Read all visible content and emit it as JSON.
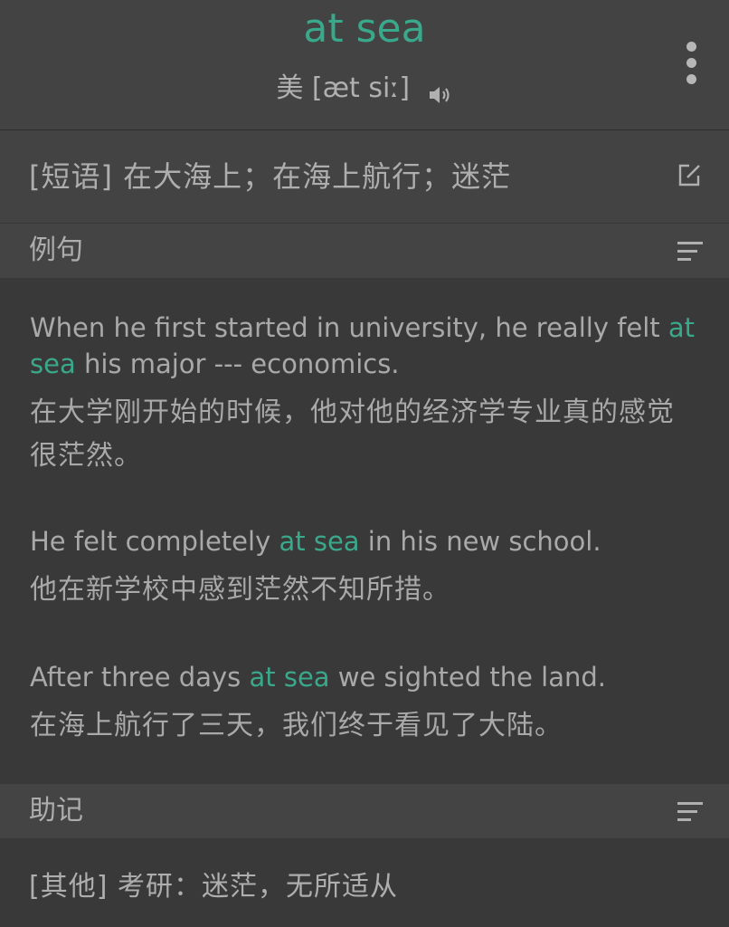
{
  "header": {
    "word": "at sea",
    "region": "美",
    "phonetic": "[æt siː]",
    "speaker_icon": "speaker-icon",
    "menu_icon": "more-vertical-icon"
  },
  "definition": {
    "text": "[短语] 在大海上；在海上航行；迷茫",
    "edit_icon": "edit-icon"
  },
  "sections": {
    "examples_title": "例句",
    "mnemonic_title": "助记",
    "sort_icon": "sort-icon"
  },
  "examples": [
    {
      "en_before": "When he first started in university, he really felt ",
      "en_highlight": "at sea",
      "en_after": " his major --- economics.",
      "zh": "在大学刚开始的时候，他对他的经济学专业真的感觉很茫然。"
    },
    {
      "en_before": "He felt completely ",
      "en_highlight": "at sea",
      "en_after": " in his new school.",
      "zh": "他在新学校中感到茫然不知所措。"
    },
    {
      "en_before": "After three days ",
      "en_highlight": "at sea",
      "en_after": " we sighted the land.",
      "zh": "在海上航行了三天，我们终于看见了大陆。"
    }
  ],
  "mnemonic": {
    "text": "[其他] 考研：迷茫，无所适从"
  },
  "colors": {
    "accent": "#3aa88a",
    "background": "#393939",
    "panel": "#434343",
    "text": "#aeaeae"
  }
}
